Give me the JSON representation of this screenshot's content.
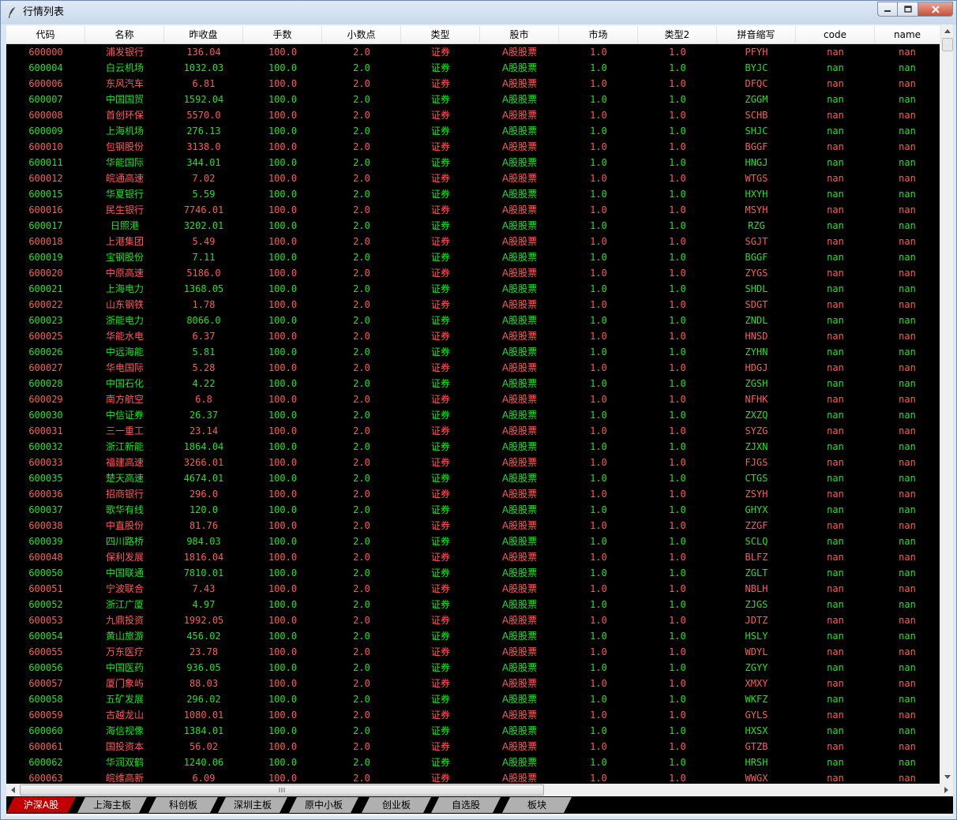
{
  "window": {
    "title": "行情列表"
  },
  "columns": [
    "代码",
    "名称",
    "昨收盘",
    "手数",
    "小数点",
    "类型",
    "股市",
    "市场",
    "类型2",
    "拼音缩写",
    "code",
    "name"
  ],
  "rows": [
    {
      "color": "red",
      "cells": [
        "600000",
        "浦发银行",
        "136.04",
        "100.0",
        "2.0",
        "证券",
        "A股股票",
        "1.0",
        "1.0",
        "PFYH",
        "nan",
        "nan"
      ]
    },
    {
      "color": "green",
      "cells": [
        "600004",
        "白云机场",
        "1032.03",
        "100.0",
        "2.0",
        "证券",
        "A股股票",
        "1.0",
        "1.0",
        "BYJC",
        "nan",
        "nan"
      ]
    },
    {
      "color": "red",
      "cells": [
        "600006",
        "东风汽车",
        "6.81",
        "100.0",
        "2.0",
        "证券",
        "A股股票",
        "1.0",
        "1.0",
        "DFQC",
        "nan",
        "nan"
      ]
    },
    {
      "color": "green",
      "cells": [
        "600007",
        "中国国贸",
        "1592.04",
        "100.0",
        "2.0",
        "证券",
        "A股股票",
        "1.0",
        "1.0",
        "ZGGM",
        "nan",
        "nan"
      ]
    },
    {
      "color": "red",
      "cells": [
        "600008",
        "首创环保",
        "5570.0",
        "100.0",
        "2.0",
        "证券",
        "A股股票",
        "1.0",
        "1.0",
        "SCHB",
        "nan",
        "nan"
      ]
    },
    {
      "color": "green",
      "cells": [
        "600009",
        "上海机场",
        "276.13",
        "100.0",
        "2.0",
        "证券",
        "A股股票",
        "1.0",
        "1.0",
        "SHJC",
        "nan",
        "nan"
      ]
    },
    {
      "color": "red",
      "cells": [
        "600010",
        "包钢股份",
        "3138.0",
        "100.0",
        "2.0",
        "证券",
        "A股股票",
        "1.0",
        "1.0",
        "BGGF",
        "nan",
        "nan"
      ]
    },
    {
      "color": "green",
      "cells": [
        "600011",
        "华能国际",
        "344.01",
        "100.0",
        "2.0",
        "证券",
        "A股股票",
        "1.0",
        "1.0",
        "HNGJ",
        "nan",
        "nan"
      ]
    },
    {
      "color": "red",
      "cells": [
        "600012",
        "皖通高速",
        "7.02",
        "100.0",
        "2.0",
        "证券",
        "A股股票",
        "1.0",
        "1.0",
        "WTGS",
        "nan",
        "nan"
      ]
    },
    {
      "color": "green",
      "cells": [
        "600015",
        "华夏银行",
        "5.59",
        "100.0",
        "2.0",
        "证券",
        "A股股票",
        "1.0",
        "1.0",
        "HXYH",
        "nan",
        "nan"
      ]
    },
    {
      "color": "red",
      "cells": [
        "600016",
        "民生银行",
        "7746.01",
        "100.0",
        "2.0",
        "证券",
        "A股股票",
        "1.0",
        "1.0",
        "MSYH",
        "nan",
        "nan"
      ]
    },
    {
      "color": "green",
      "cells": [
        "600017",
        "日照港",
        "3202.01",
        "100.0",
        "2.0",
        "证券",
        "A股股票",
        "1.0",
        "1.0",
        "RZG",
        "nan",
        "nan"
      ]
    },
    {
      "color": "red",
      "cells": [
        "600018",
        "上港集团",
        "5.49",
        "100.0",
        "2.0",
        "证券",
        "A股股票",
        "1.0",
        "1.0",
        "SGJT",
        "nan",
        "nan"
      ]
    },
    {
      "color": "green",
      "cells": [
        "600019",
        "宝钢股份",
        "7.11",
        "100.0",
        "2.0",
        "证券",
        "A股股票",
        "1.0",
        "1.0",
        "BGGF",
        "nan",
        "nan"
      ]
    },
    {
      "color": "red",
      "cells": [
        "600020",
        "中原高速",
        "5186.0",
        "100.0",
        "2.0",
        "证券",
        "A股股票",
        "1.0",
        "1.0",
        "ZYGS",
        "nan",
        "nan"
      ]
    },
    {
      "color": "green",
      "cells": [
        "600021",
        "上海电力",
        "1368.05",
        "100.0",
        "2.0",
        "证券",
        "A股股票",
        "1.0",
        "1.0",
        "SHDL",
        "nan",
        "nan"
      ]
    },
    {
      "color": "red",
      "cells": [
        "600022",
        "山东钢铁",
        "1.78",
        "100.0",
        "2.0",
        "证券",
        "A股股票",
        "1.0",
        "1.0",
        "SDGT",
        "nan",
        "nan"
      ]
    },
    {
      "color": "green",
      "cells": [
        "600023",
        "浙能电力",
        "8066.0",
        "100.0",
        "2.0",
        "证券",
        "A股股票",
        "1.0",
        "1.0",
        "ZNDL",
        "nan",
        "nan"
      ]
    },
    {
      "color": "red",
      "cells": [
        "600025",
        "华能水电",
        "6.37",
        "100.0",
        "2.0",
        "证券",
        "A股股票",
        "1.0",
        "1.0",
        "HNSD",
        "nan",
        "nan"
      ]
    },
    {
      "color": "green",
      "cells": [
        "600026",
        "中远海能",
        "5.81",
        "100.0",
        "2.0",
        "证券",
        "A股股票",
        "1.0",
        "1.0",
        "ZYHN",
        "nan",
        "nan"
      ]
    },
    {
      "color": "red",
      "cells": [
        "600027",
        "华电国际",
        "5.28",
        "100.0",
        "2.0",
        "证券",
        "A股股票",
        "1.0",
        "1.0",
        "HDGJ",
        "nan",
        "nan"
      ]
    },
    {
      "color": "green",
      "cells": [
        "600028",
        "中国石化",
        "4.22",
        "100.0",
        "2.0",
        "证券",
        "A股股票",
        "1.0",
        "1.0",
        "ZGSH",
        "nan",
        "nan"
      ]
    },
    {
      "color": "red",
      "cells": [
        "600029",
        "南方航空",
        "6.8",
        "100.0",
        "2.0",
        "证券",
        "A股股票",
        "1.0",
        "1.0",
        "NFHK",
        "nan",
        "nan"
      ]
    },
    {
      "color": "green",
      "cells": [
        "600030",
        "中信证券",
        "26.37",
        "100.0",
        "2.0",
        "证券",
        "A股股票",
        "1.0",
        "1.0",
        "ZXZQ",
        "nan",
        "nan"
      ]
    },
    {
      "color": "red",
      "cells": [
        "600031",
        "三一重工",
        "23.14",
        "100.0",
        "2.0",
        "证券",
        "A股股票",
        "1.0",
        "1.0",
        "SYZG",
        "nan",
        "nan"
      ]
    },
    {
      "color": "green",
      "cells": [
        "600032",
        "浙江新能",
        "1864.04",
        "100.0",
        "2.0",
        "证券",
        "A股股票",
        "1.0",
        "1.0",
        "ZJXN",
        "nan",
        "nan"
      ]
    },
    {
      "color": "red",
      "cells": [
        "600033",
        "福建高速",
        "3266.01",
        "100.0",
        "2.0",
        "证券",
        "A股股票",
        "1.0",
        "1.0",
        "FJGS",
        "nan",
        "nan"
      ]
    },
    {
      "color": "green",
      "cells": [
        "600035",
        "楚天高速",
        "4674.01",
        "100.0",
        "2.0",
        "证券",
        "A股股票",
        "1.0",
        "1.0",
        "CTGS",
        "nan",
        "nan"
      ]
    },
    {
      "color": "red",
      "cells": [
        "600036",
        "招商银行",
        "296.0",
        "100.0",
        "2.0",
        "证券",
        "A股股票",
        "1.0",
        "1.0",
        "ZSYH",
        "nan",
        "nan"
      ]
    },
    {
      "color": "green",
      "cells": [
        "600037",
        "歌华有线",
        "120.0",
        "100.0",
        "2.0",
        "证券",
        "A股股票",
        "1.0",
        "1.0",
        "GHYX",
        "nan",
        "nan"
      ]
    },
    {
      "color": "red",
      "cells": [
        "600038",
        "中直股份",
        "81.76",
        "100.0",
        "2.0",
        "证券",
        "A股股票",
        "1.0",
        "1.0",
        "ZZGF",
        "nan",
        "nan"
      ]
    },
    {
      "color": "green",
      "cells": [
        "600039",
        "四川路桥",
        "984.03",
        "100.0",
        "2.0",
        "证券",
        "A股股票",
        "1.0",
        "1.0",
        "SCLQ",
        "nan",
        "nan"
      ]
    },
    {
      "color": "red",
      "cells": [
        "600048",
        "保利发展",
        "1816.04",
        "100.0",
        "2.0",
        "证券",
        "A股股票",
        "1.0",
        "1.0",
        "BLFZ",
        "nan",
        "nan"
      ]
    },
    {
      "color": "green",
      "cells": [
        "600050",
        "中国联通",
        "7810.01",
        "100.0",
        "2.0",
        "证券",
        "A股股票",
        "1.0",
        "1.0",
        "ZGLT",
        "nan",
        "nan"
      ]
    },
    {
      "color": "red",
      "cells": [
        "600051",
        "宁波联合",
        "7.43",
        "100.0",
        "2.0",
        "证券",
        "A股股票",
        "1.0",
        "1.0",
        "NBLH",
        "nan",
        "nan"
      ]
    },
    {
      "color": "green",
      "cells": [
        "600052",
        "浙江广厦",
        "4.97",
        "100.0",
        "2.0",
        "证券",
        "A股股票",
        "1.0",
        "1.0",
        "ZJGS",
        "nan",
        "nan"
      ]
    },
    {
      "color": "red",
      "cells": [
        "600053",
        "九鼎投资",
        "1992.05",
        "100.0",
        "2.0",
        "证券",
        "A股股票",
        "1.0",
        "1.0",
        "JDTZ",
        "nan",
        "nan"
      ]
    },
    {
      "color": "green",
      "cells": [
        "600054",
        "黄山旅游",
        "456.02",
        "100.0",
        "2.0",
        "证券",
        "A股股票",
        "1.0",
        "1.0",
        "HSLY",
        "nan",
        "nan"
      ]
    },
    {
      "color": "red",
      "cells": [
        "600055",
        "万东医疗",
        "23.78",
        "100.0",
        "2.0",
        "证券",
        "A股股票",
        "1.0",
        "1.0",
        "WDYL",
        "nan",
        "nan"
      ]
    },
    {
      "color": "green",
      "cells": [
        "600056",
        "中国医药",
        "936.05",
        "100.0",
        "2.0",
        "证券",
        "A股股票",
        "1.0",
        "1.0",
        "ZGYY",
        "nan",
        "nan"
      ]
    },
    {
      "color": "red",
      "cells": [
        "600057",
        "厦门象屿",
        "88.03",
        "100.0",
        "2.0",
        "证券",
        "A股股票",
        "1.0",
        "1.0",
        "XMXY",
        "nan",
        "nan"
      ]
    },
    {
      "color": "green",
      "cells": [
        "600058",
        "五矿发展",
        "296.02",
        "100.0",
        "2.0",
        "证券",
        "A股股票",
        "1.0",
        "1.0",
        "WKFZ",
        "nan",
        "nan"
      ]
    },
    {
      "color": "red",
      "cells": [
        "600059",
        "古越龙山",
        "1080.01",
        "100.0",
        "2.0",
        "证券",
        "A股股票",
        "1.0",
        "1.0",
        "GYLS",
        "nan",
        "nan"
      ]
    },
    {
      "color": "green",
      "cells": [
        "600060",
        "海信视像",
        "1384.01",
        "100.0",
        "2.0",
        "证券",
        "A股股票",
        "1.0",
        "1.0",
        "HXSX",
        "nan",
        "nan"
      ]
    },
    {
      "color": "red",
      "cells": [
        "600061",
        "国投资本",
        "56.02",
        "100.0",
        "2.0",
        "证券",
        "A股股票",
        "1.0",
        "1.0",
        "GTZB",
        "nan",
        "nan"
      ]
    },
    {
      "color": "green",
      "cells": [
        "600062",
        "华润双鹤",
        "1240.06",
        "100.0",
        "2.0",
        "证券",
        "A股股票",
        "1.0",
        "1.0",
        "HRSH",
        "nan",
        "nan"
      ]
    },
    {
      "color": "red",
      "cells": [
        "600063",
        "皖维高新",
        "6.09",
        "100.0",
        "2.0",
        "证券",
        "A股股票",
        "1.0",
        "1.0",
        "WWGX",
        "nan",
        "nan"
      ]
    }
  ],
  "tabs": [
    {
      "label": "沪深A股",
      "active": true
    },
    {
      "label": "上海主板",
      "active": false
    },
    {
      "label": "科创板",
      "active": false
    },
    {
      "label": "深圳主板",
      "active": false
    },
    {
      "label": "原中小板",
      "active": false
    },
    {
      "label": "创业板",
      "active": false
    },
    {
      "label": "自选股",
      "active": false
    },
    {
      "label": "板块",
      "active": false
    }
  ],
  "colors": {
    "up": "#ff5a5a",
    "down": "#22e322",
    "grid_bg": "#000000",
    "active_tab": "#c00000",
    "inactive_tab": "#b0b0b0"
  }
}
